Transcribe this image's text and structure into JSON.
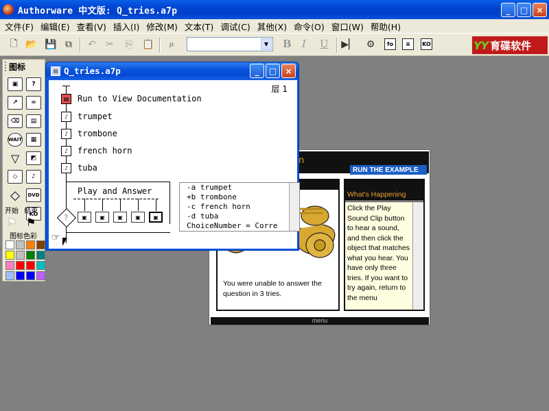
{
  "app": {
    "title": "Authorware 中文版: Q_tries.a7p",
    "controls": {
      "minimize": "_",
      "maximize": "□",
      "close": "×"
    }
  },
  "menubar": {
    "items": [
      "文件(F)",
      "编辑(E)",
      "查看(V)",
      "插入(I)",
      "修改(M)",
      "文本(T)",
      "调试(C)",
      "其他(X)",
      "命令(O)",
      "窗口(W)",
      "帮助(H)"
    ]
  },
  "toolbar": {
    "icons": [
      "new-icon",
      "open-icon",
      "save-all-icon",
      "import-icon",
      "undo-icon",
      "cut-icon",
      "copy-icon",
      "paste-icon",
      "find-icon",
      "bold-icon",
      "italic-icon",
      "underline-icon",
      "restart-icon",
      "control-panel-icon",
      "functions-icon",
      "variables-icon",
      "knowledge-objects-icon"
    ],
    "style_combo_value": "",
    "bold": "B",
    "italic": "I",
    "underline": "U",
    "brand_logo": "YY",
    "brand_text": "育碟软件"
  },
  "palette": {
    "title": "图标",
    "icons": [
      "display-icon",
      "interaction-icon",
      "motion-icon",
      "calculation-icon",
      "erase-icon",
      "map-icon",
      "wait-icon",
      "digital-movie-icon",
      "navigate-icon",
      "framework-icon",
      "decision-icon",
      "sound-icon",
      "interaction-diamond-icon",
      "dvd-icon",
      "knowledge-object-icon"
    ],
    "start_label": "开始",
    "end_label": "结束",
    "color_label": "图标色彩",
    "colors": [
      "#ffffff",
      "#c0c0c0",
      "#ff8000",
      "#804000",
      "#ffff00",
      "#c0c0c0",
      "#008000",
      "#008080",
      "#ff80c0",
      "#ff0000",
      "#ff0000",
      "#00c0c0",
      "#a0c0ff",
      "#0000ff",
      "#0000ff",
      "#c060ff"
    ]
  },
  "design_window": {
    "title": "Q_tries.a7p",
    "layer": "层 1",
    "flow": [
      {
        "label": "Run to View Documentation",
        "icon": "map-icon"
      },
      {
        "label": "trumpet",
        "icon": "sound-icon"
      },
      {
        "label": "trombone",
        "icon": "sound-icon"
      },
      {
        "label": "french horn",
        "icon": "sound-icon"
      },
      {
        "label": "tuba",
        "icon": "sound-icon"
      }
    ],
    "interaction_label": "Play and Answer",
    "calc_lines": [
      "-a trumpet",
      "+b trombone",
      "-c french horn",
      "-d tuba",
      " ChoiceNumber = Corre"
    ]
  },
  "example_window": {
    "title_fragment": "n",
    "run_label": "RUN THE EXAMPLE",
    "fail_text": "You were unable to answer the question in 3 tries.",
    "whats_happening_title": "What's Happening",
    "whats_happening_text": "Click the Play Sound Clip button to hear a sound, and then click the object that matches what you hear. You have only three tries. If you want to try again, return to the menu",
    "menu_label": "menu"
  }
}
